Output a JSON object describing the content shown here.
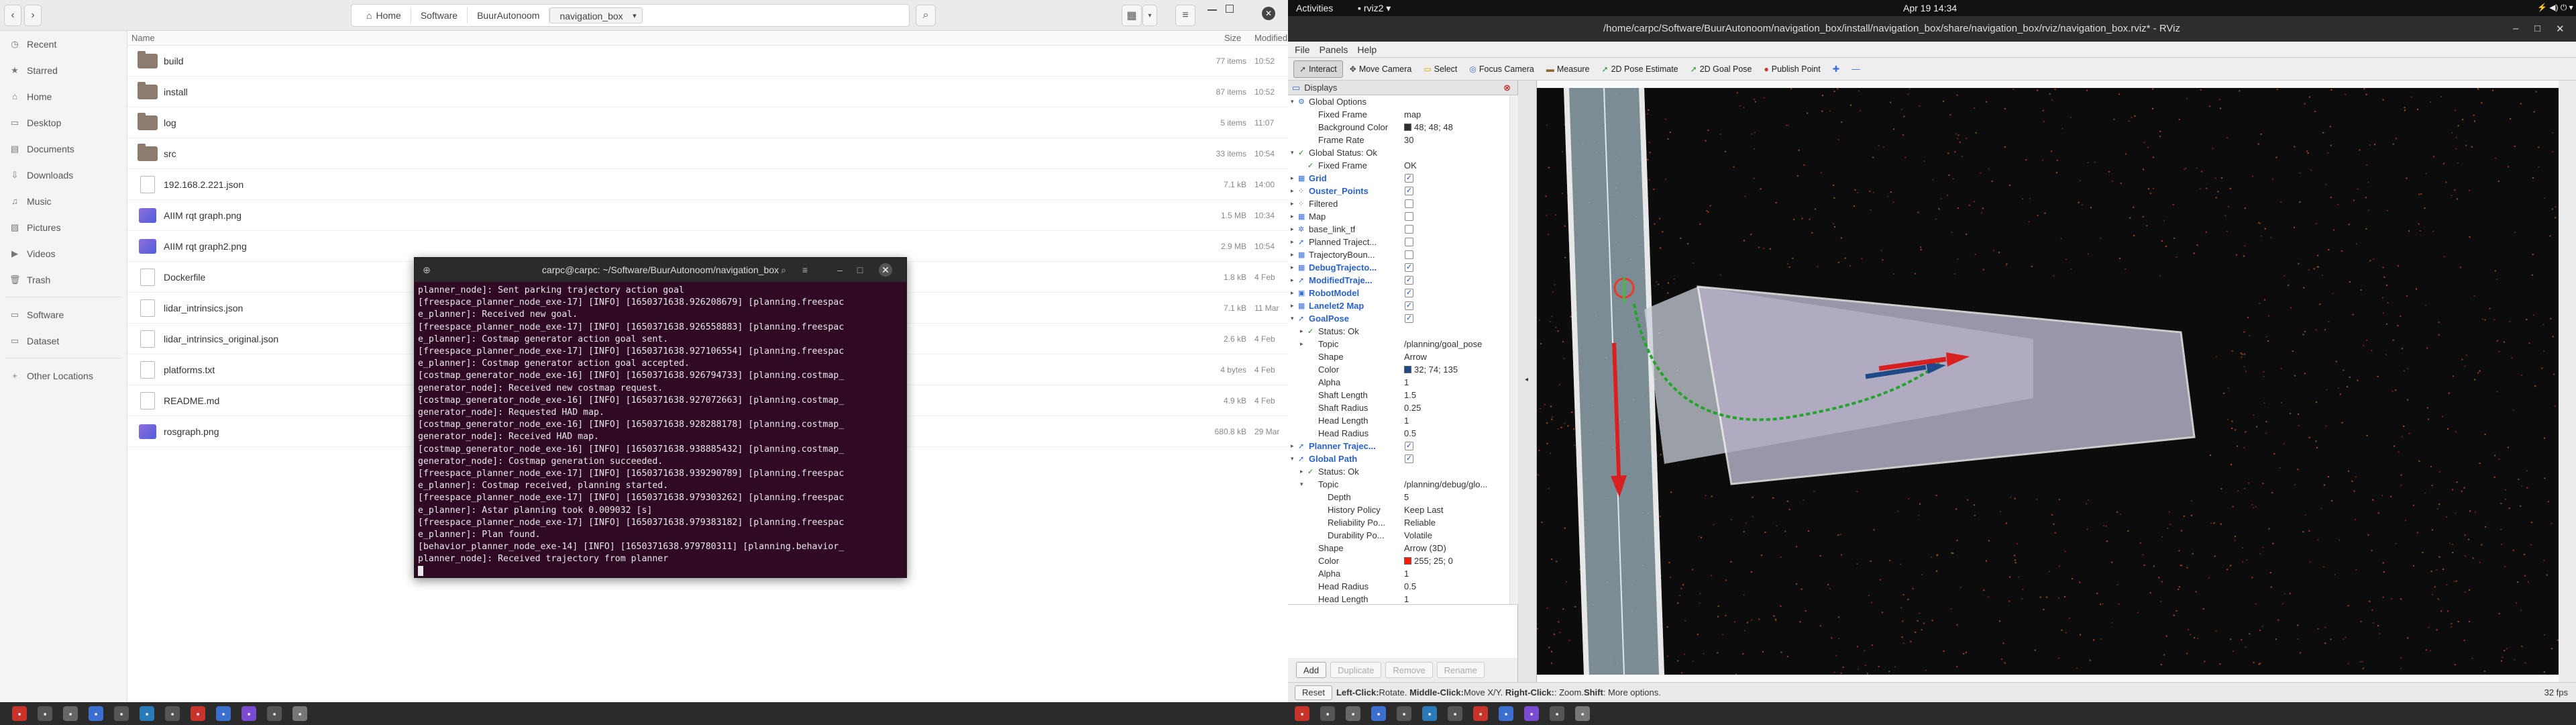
{
  "files": {
    "path": [
      "Home",
      "Software",
      "BuurAutonoom",
      "navigation_box"
    ],
    "sidebar": [
      "Recent",
      "Starred",
      "Home",
      "Desktop",
      "Documents",
      "Downloads",
      "Music",
      "Pictures",
      "Videos",
      "Trash",
      "Software",
      "Dataset",
      "Other Locations"
    ],
    "sidebar_icons": [
      "clock-icon",
      "star-icon",
      "home-icon",
      "desktop-icon",
      "document-icon",
      "download-icon",
      "music-icon",
      "picture-icon",
      "video-icon",
      "trash-icon",
      "folder-icon",
      "folder-icon",
      "plus-icon"
    ],
    "columns": {
      "name": "Name",
      "size": "Size",
      "modified": "Modified"
    },
    "rows": [
      {
        "name": "build",
        "size": "77 items",
        "mod": "10:52",
        "kind": "folder"
      },
      {
        "name": "install",
        "size": "87 items",
        "mod": "10:52",
        "kind": "folder"
      },
      {
        "name": "log",
        "size": "5 items",
        "mod": "11:07",
        "kind": "folder"
      },
      {
        "name": "src",
        "size": "33 items",
        "mod": "10:54",
        "kind": "folder"
      },
      {
        "name": "192.168.2.221.json",
        "size": "7.1 kB",
        "mod": "14:00",
        "kind": "doc"
      },
      {
        "name": "AIIM rqt graph.png",
        "size": "1.5 MB",
        "mod": "10:34",
        "kind": "img"
      },
      {
        "name": "AIIM rqt graph2.png",
        "size": "2.9 MB",
        "mod": "10:54",
        "kind": "img"
      },
      {
        "name": "Dockerfile",
        "size": "1.8 kB",
        "mod": "4 Feb",
        "kind": "doc"
      },
      {
        "name": "lidar_intrinsics.json",
        "size": "7.1 kB",
        "mod": "11 Mar",
        "kind": "doc"
      },
      {
        "name": "lidar_intrinsics_original.json",
        "size": "2.6 kB",
        "mod": "4 Feb",
        "kind": "doc"
      },
      {
        "name": "platforms.txt",
        "size": "4 bytes",
        "mod": "4 Feb",
        "kind": "doc"
      },
      {
        "name": "README.md",
        "size": "4.9 kB",
        "mod": "4 Feb",
        "kind": "doc"
      },
      {
        "name": "rosgraph.png",
        "size": "680.8 kB",
        "mod": "29 Mar",
        "kind": "img"
      }
    ]
  },
  "terminal": {
    "title": "carpc@carpc: ~/Software/BuurAutonoom/navigation_box",
    "lines": [
      "planner_node]: Sent parking trajectory action goal",
      "[freespace_planner_node_exe-17] [INFO] [1650371638.926208679] [planning.freespac",
      "e_planner]: Received new goal.",
      "[freespace_planner_node_exe-17] [INFO] [1650371638.926558883] [planning.freespac",
      "e_planner]: Costmap generator action goal sent.",
      "[freespace_planner_node_exe-17] [INFO] [1650371638.927106554] [planning.freespac",
      "e_planner]: Costmap generator action goal accepted.",
      "[costmap_generator_node_exe-16] [INFO] [1650371638.926794733] [planning.costmap_",
      "generator_node]: Received new costmap request.",
      "[costmap_generator_node_exe-16] [INFO] [1650371638.927072663] [planning.costmap_",
      "generator_node]: Requested HAD map.",
      "[costmap_generator_node_exe-16] [INFO] [1650371638.928288178] [planning.costmap_",
      "generator_node]: Received HAD map.",
      "[costmap_generator_node_exe-16] [INFO] [1650371638.938885432] [planning.costmap_",
      "generator_node]: Costmap generation succeeded.",
      "[freespace_planner_node_exe-17] [INFO] [1650371638.939290789] [planning.freespac",
      "e_planner]: Costmap received, planning started.",
      "[freespace_planner_node_exe-17] [INFO] [1650371638.979303262] [planning.freespac",
      "e_planner]: Astar planning took 0.009032 [s]",
      "[freespace_planner_node_exe-17] [INFO] [1650371638.979383182] [planning.freespac",
      "e_planner]: Plan found.",
      "[behavior_planner_node_exe-14] [INFO] [1650371638.979780311] [planning.behavior_",
      "planner_node]: Received trajectory from planner"
    ]
  },
  "topbar": {
    "activities": "Activities",
    "app": "rviz2",
    "clock": "Apr 19  14:34"
  },
  "rviz": {
    "title": "/home/carpc/Software/BuurAutonoom/navigation_box/install/navigation_box/share/navigation_box/rviz/navigation_box.rviz* - RViz",
    "menu": [
      "File",
      "Panels",
      "Help"
    ],
    "tools": [
      "Interact",
      "Move Camera",
      "Select",
      "Focus Camera",
      "Measure",
      "2D Pose Estimate",
      "2D Goal Pose",
      "Publish Point"
    ],
    "tool_icons": [
      "cursor-icon",
      "move-icon",
      "select-icon",
      "focus-icon",
      "ruler-icon",
      "pose-arrow-icon",
      "goal-arrow-icon",
      "point-icon"
    ],
    "panel_title": "Displays",
    "tree": [
      {
        "ind": 0,
        "exp": "▾",
        "ico": "⚙",
        "name": "Global Options",
        "val": ""
      },
      {
        "ind": 2,
        "exp": "",
        "ico": "",
        "name": "Fixed Frame",
        "val": "map"
      },
      {
        "ind": 2,
        "exp": "",
        "ico": "",
        "name": "Background Color",
        "val": "48; 48; 48",
        "sw": "#303030"
      },
      {
        "ind": 2,
        "exp": "",
        "ico": "",
        "name": "Frame Rate",
        "val": "30"
      },
      {
        "ind": 0,
        "exp": "▾",
        "ico": "✓",
        "name": "Global Status: Ok",
        "val": ""
      },
      {
        "ind": 2,
        "exp": "",
        "ico": "✓",
        "name": "Fixed Frame",
        "val": "OK"
      },
      {
        "ind": 0,
        "exp": "▸",
        "ico": "▦",
        "name": "Grid",
        "cb": "✓",
        "blue": true
      },
      {
        "ind": 0,
        "exp": "▸",
        "ico": "⁘",
        "name": "Ouster_Points",
        "cb": "✓",
        "blue": true
      },
      {
        "ind": 0,
        "exp": "▸",
        "ico": "⁘",
        "name": "Filtered",
        "cb": ""
      },
      {
        "ind": 0,
        "exp": "▸",
        "ico": "▦",
        "name": "Map",
        "cb": ""
      },
      {
        "ind": 0,
        "exp": "▸",
        "ico": "✲",
        "name": "base_link_tf",
        "cb": ""
      },
      {
        "ind": 0,
        "exp": "▸",
        "ico": "➚",
        "name": "Planned Traject...",
        "cb": ""
      },
      {
        "ind": 0,
        "exp": "▸",
        "ico": "▦",
        "name": "TrajectoryBoun...",
        "cb": ""
      },
      {
        "ind": 0,
        "exp": "▸",
        "ico": "▦",
        "name": "DebugTrajecto...",
        "cb": "✓",
        "blue": true
      },
      {
        "ind": 0,
        "exp": "▸",
        "ico": "➚",
        "name": "ModifiedTraje...",
        "cb": "✓",
        "blue": true
      },
      {
        "ind": 0,
        "exp": "▸",
        "ico": "▣",
        "name": "RobotModel",
        "cb": "✓",
        "blue": true
      },
      {
        "ind": 0,
        "exp": "▸",
        "ico": "▦",
        "name": "Lanelet2 Map",
        "cb": "✓",
        "blue": true
      },
      {
        "ind": 0,
        "exp": "▾",
        "ico": "➚",
        "name": "GoalPose",
        "cb": "✓",
        "blue": true
      },
      {
        "ind": 2,
        "exp": "▸",
        "ico": "✓",
        "name": "Status: Ok",
        "val": ""
      },
      {
        "ind": 2,
        "exp": "▸",
        "ico": "",
        "name": "Topic",
        "val": "/planning/goal_pose"
      },
      {
        "ind": 2,
        "exp": "",
        "ico": "",
        "name": "Shape",
        "val": "Arrow"
      },
      {
        "ind": 2,
        "exp": "",
        "ico": "",
        "name": "Color",
        "val": "32; 74; 135",
        "sw": "#204a87"
      },
      {
        "ind": 2,
        "exp": "",
        "ico": "",
        "name": "Alpha",
        "val": "1"
      },
      {
        "ind": 2,
        "exp": "",
        "ico": "",
        "name": "Shaft Length",
        "val": "1.5"
      },
      {
        "ind": 2,
        "exp": "",
        "ico": "",
        "name": "Shaft Radius",
        "val": "0.25"
      },
      {
        "ind": 2,
        "exp": "",
        "ico": "",
        "name": "Head Length",
        "val": "1"
      },
      {
        "ind": 2,
        "exp": "",
        "ico": "",
        "name": "Head Radius",
        "val": "0.5"
      },
      {
        "ind": 0,
        "exp": "▸",
        "ico": "➚",
        "name": "Planner Trajec...",
        "cb": "✓",
        "blue": true
      },
      {
        "ind": 0,
        "exp": "▾",
        "ico": "➚",
        "name": "Global Path",
        "cb": "✓",
        "blue": true
      },
      {
        "ind": 2,
        "exp": "▸",
        "ico": "✓",
        "name": "Status: Ok",
        "val": ""
      },
      {
        "ind": 2,
        "exp": "▾",
        "ico": "",
        "name": "Topic",
        "val": "/planning/debug/glo..."
      },
      {
        "ind": 4,
        "exp": "",
        "ico": "",
        "name": "Depth",
        "val": "5"
      },
      {
        "ind": 4,
        "exp": "",
        "ico": "",
        "name": "History Policy",
        "val": "Keep Last"
      },
      {
        "ind": 4,
        "exp": "",
        "ico": "",
        "name": "Reliability Po...",
        "val": "Reliable"
      },
      {
        "ind": 4,
        "exp": "",
        "ico": "",
        "name": "Durability Po...",
        "val": "Volatile"
      },
      {
        "ind": 2,
        "exp": "",
        "ico": "",
        "name": "Shape",
        "val": "Arrow (3D)"
      },
      {
        "ind": 2,
        "exp": "",
        "ico": "",
        "name": "Color",
        "val": "255; 25; 0",
        "sw": "#ff1900"
      },
      {
        "ind": 2,
        "exp": "",
        "ico": "",
        "name": "Alpha",
        "val": "1"
      },
      {
        "ind": 2,
        "exp": "",
        "ico": "",
        "name": "Head Radius",
        "val": "0.5"
      },
      {
        "ind": 2,
        "exp": "",
        "ico": "",
        "name": "Head Length",
        "val": "1"
      }
    ],
    "buttons": [
      "Add",
      "Duplicate",
      "Remove",
      "Rename"
    ],
    "status": {
      "reset": "Reset",
      "hint_left": "Left-Click:",
      "hint_left_t": " Rotate. ",
      "hint_mid": "Middle-Click:",
      "hint_mid_t": " Move X/Y. ",
      "hint_right": "Right-Click:",
      "hint_right_t": ": Zoom. ",
      "hint_shift": "Shift",
      "hint_shift_t": ": More options.",
      "fps": "32 fps"
    }
  },
  "colors": {
    "goal_pose": "#204a87",
    "global_path": "#ff1900",
    "background": "#303030",
    "terminal_bg": "#300a24"
  }
}
